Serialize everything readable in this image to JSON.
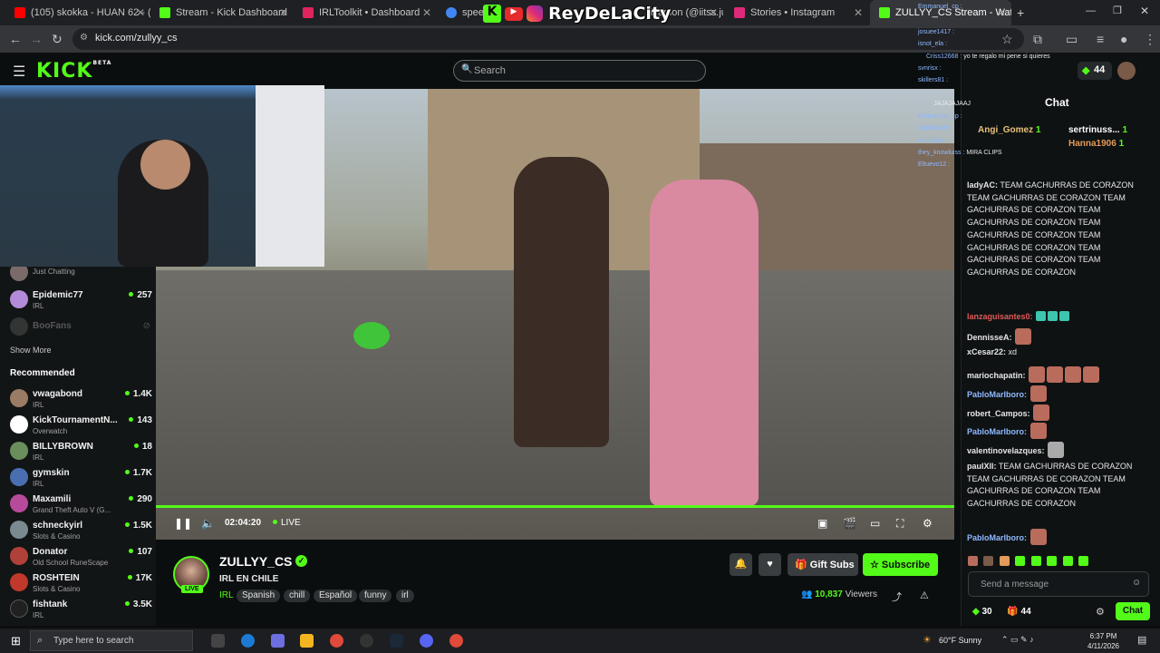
{
  "browser": {
    "tabs": [
      {
        "label": "(105) skokka - HUAN 62 - (Vide",
        "color": "#ff0000"
      },
      {
        "label": "Stream - Kick Dashboard",
        "color": "#53fc18"
      },
      {
        "label": "IRLToolkit • Dashboard",
        "color": "#e0245e"
      },
      {
        "label": "speed t",
        "color": "#4285f4"
      },
      {
        "label": "izamon (@iitss.ju",
        "color": "#888888"
      },
      {
        "label": "Stories • Instagram",
        "color": "#dd2a7b"
      },
      {
        "label": "ZULLYY_CS Stream - Watc",
        "color": "#53fc18"
      }
    ],
    "url": "kick.com/zullyy_cs"
  },
  "overlay_brand": "ReyDeLaCity",
  "kick": {
    "logo": "KICK",
    "logo_badge": "BETA",
    "search_placeholder": "Search"
  },
  "sidebar": {
    "following": [
      {
        "name": "Epidemic77",
        "category": "IRL",
        "viewers": "257",
        "color": "#b48bd8"
      },
      {
        "name": "BooFans",
        "category": "",
        "viewers": "",
        "color": "#555555"
      }
    ],
    "partial_top": {
      "name": "Just Chatting"
    },
    "show_more": "Show More",
    "recommended_title": "Recommended",
    "recommended": [
      {
        "name": "vwagabond",
        "category": "IRL",
        "viewers": "1.4K",
        "color": "#9a7c64"
      },
      {
        "name": "KickTournamentN...",
        "category": "Overwatch",
        "viewers": "143",
        "color": "#ffffff"
      },
      {
        "name": "BILLYBROWN",
        "category": "IRL",
        "viewers": "18",
        "color": "#6b8f5c"
      },
      {
        "name": "gymskin",
        "category": "IRL",
        "viewers": "1.7K",
        "color": "#4a6fb0"
      },
      {
        "name": "Maxamili",
        "category": "Grand Theft Auto V (G...",
        "viewers": "290",
        "color": "#b84a9c"
      },
      {
        "name": "schneckyirl",
        "category": "Slots & Casino",
        "viewers": "1.5K",
        "color": "#7a8a90"
      },
      {
        "name": "Donator",
        "category": "Old School RuneScape",
        "viewers": "107",
        "color": "#b0403a"
      },
      {
        "name": "ROSHTEIN",
        "category": "Slots & Casino",
        "viewers": "17K",
        "color": "#c0392b"
      },
      {
        "name": "fishtank",
        "category": "IRL",
        "viewers": "3.5K",
        "color": "#202020"
      }
    ]
  },
  "player": {
    "time": "02:04:20",
    "live_label": "LIVE",
    "progress": 1.0
  },
  "stream": {
    "name": "ZULLYY_CS",
    "title": "IRL EN CHILE",
    "category": "IRL",
    "tags": [
      "Spanish",
      "chill",
      "Español",
      "funny",
      "irl"
    ],
    "live_badge": "LIVE",
    "gift_label": "Gift Subs",
    "subscribe_label": "Subscribe",
    "viewers": "10,837",
    "viewers_label": "Viewers"
  },
  "chat": {
    "title": "Chat",
    "count": "44",
    "top_gifters": [
      {
        "name": "Angi_Gomez",
        "count": "1"
      },
      {
        "name": "sertrinuss...",
        "count": "1"
      },
      {
        "name": "Hanna1906",
        "count": "1"
      }
    ],
    "messages": [
      {
        "user": "ladyAC:",
        "text": "TEAM GACHURRAS DE CORAZON TEAM GACHURRAS DE CORAZON TEAM GACHURRAS DE CORAZON TEAM GACHURRAS DE CORAZON TEAM GACHURRAS DE CORAZON TEAM GACHURRAS DE CORAZON TEAM GACHURRAS DE CORAZON TEAM GACHURRAS DE CORAZON",
        "color": "#ffffff"
      },
      {
        "user": "lanzaguisantes0:",
        "text": "",
        "color": "#e05a5a"
      },
      {
        "user": "DennisseA:",
        "text": "",
        "color": "#ffffff"
      },
      {
        "user": "xCesar22:",
        "text": "xd",
        "color": "#ffffff"
      },
      {
        "user": "mariochapatin:",
        "text": "",
        "color": "#ffffff"
      },
      {
        "user": "PabloMarlboro:",
        "text": "",
        "color": "#8eb9ff"
      },
      {
        "user": "robert_Campos:",
        "text": "",
        "color": "#ffffff"
      },
      {
        "user": "PabloMarlboro:",
        "text": "",
        "color": "#8eb9ff"
      },
      {
        "user": "valentinovelazques:",
        "text": "",
        "color": "#ffffff"
      },
      {
        "user": "paulXll:",
        "text": "TEAM GACHURRAS DE CORAZON TEAM GACHURRAS DE CORAZON TEAM GACHURRAS DE CORAZON TEAM GACHURRAS DE CORAZON",
        "color": "#ffffff"
      },
      {
        "user": "PabloMarlboro:",
        "text": "",
        "color": "#8eb9ff"
      }
    ],
    "input_placeholder": "Send a message",
    "footer_count_a": "30",
    "footer_count_b": "44",
    "send_label": "Chat"
  },
  "overlay_chat": [
    {
      "user": "Emmanuel_cp :",
      "text": ""
    },
    {
      "user": "josuee1417 :",
      "text": ""
    },
    {
      "user": "isnot_ela :",
      "text": ""
    },
    {
      "user": "Criss12668 :",
      "text": "yo te regalo mi pene si quieres"
    },
    {
      "user": "svnrisx :",
      "text": ""
    },
    {
      "user": "skillers81 :",
      "text": ""
    },
    {
      "user": "- :",
      "text": "JAJAJAJAAJ"
    },
    {
      "user": "Emmanuel_cp :",
      "text": ""
    },
    {
      "user": "clipdelacity :",
      "text": ""
    },
    {
      "user": "neucliper :",
      "text": ""
    },
    {
      "user": "they_knowluiss :",
      "text": "MIRA CLIPS"
    },
    {
      "user": "Eltuevo12 :",
      "text": ""
    }
  ],
  "taskbar": {
    "search_placeholder": "Type here to search",
    "weather": "60°F  Sunny",
    "time": "6:37 PM",
    "date": "4/11/2026"
  }
}
